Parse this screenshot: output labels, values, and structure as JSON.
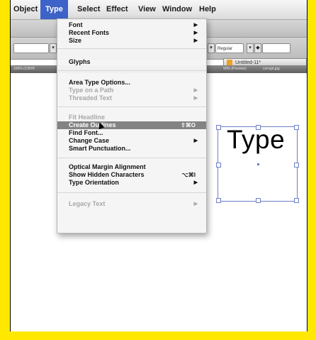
{
  "menubar": {
    "items": [
      "Object",
      "Type",
      "Select",
      "Effect",
      "View",
      "Window",
      "Help"
    ],
    "active": "Type"
  },
  "toolbar": {
    "font_style": "Regular"
  },
  "document_tab": {
    "title": "Untitled-11*"
  },
  "panel_tabs": [
    "100% (CMYK",
    "90% (Preview)",
    "corrupt.jpg"
  ],
  "canvas": {
    "text": "Type"
  },
  "type_menu": {
    "items": [
      {
        "label": "Font",
        "submenu": true,
        "disabled": false
      },
      {
        "label": "Recent Fonts",
        "submenu": true,
        "disabled": false
      },
      {
        "label": "Size",
        "submenu": true,
        "disabled": false
      },
      {
        "label": "Glyphs",
        "submenu": false,
        "disabled": false
      },
      {
        "label": "Area Type Options...",
        "submenu": false,
        "disabled": false
      },
      {
        "label": "Type on a Path",
        "submenu": true,
        "disabled": true
      },
      {
        "label": "Threaded Text",
        "submenu": true,
        "disabled": true
      },
      {
        "label": "Fit Headline",
        "submenu": false,
        "disabled": true
      },
      {
        "label": "Create Outlines",
        "submenu": false,
        "disabled": false,
        "highlighted": true,
        "shortcut": "⇧⌘O"
      },
      {
        "label": "Find Font...",
        "submenu": false,
        "disabled": false
      },
      {
        "label": "Change Case",
        "submenu": true,
        "disabled": false
      },
      {
        "label": "Smart Punctuation...",
        "submenu": false,
        "disabled": false
      },
      {
        "label": "Optical Margin Alignment",
        "submenu": false,
        "disabled": false
      },
      {
        "label": "Show Hidden Characters",
        "submenu": false,
        "disabled": false,
        "shortcut": "⌥⌘I"
      },
      {
        "label": "Type Orientation",
        "submenu": true,
        "disabled": false
      },
      {
        "label": "Legacy Text",
        "submenu": true,
        "disabled": true
      }
    ]
  },
  "colors": {
    "border_highlight": "#ffe800",
    "menu_highlight": "#838383",
    "active_menu": "#3d63c8",
    "selection_box": "#6f7fc8"
  }
}
